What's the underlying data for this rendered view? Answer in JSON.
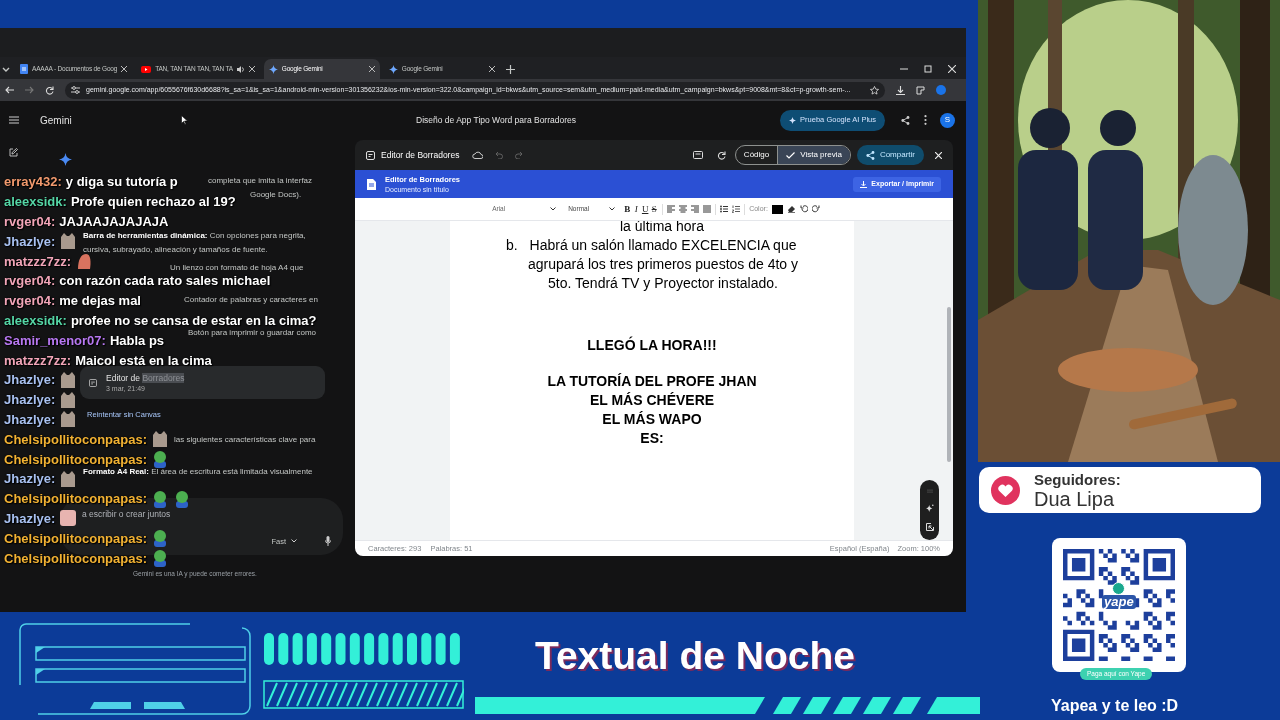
{
  "browser": {
    "tabs": [
      {
        "title": "AAAAA - Documentos de Goog",
        "kind": "docs",
        "audio": false,
        "selected": false
      },
      {
        "title": "TAN, TAN TAN TAN, TAN TA",
        "kind": "video",
        "audio": true,
        "selected": false
      },
      {
        "title": "Google Gemini",
        "kind": "gemini",
        "audio": false,
        "selected": true
      },
      {
        "title": "Google Gemini",
        "kind": "gemini",
        "audio": false,
        "selected": false
      }
    ],
    "url": "gemini.google.com/app/6055676f630d6688?is_sa=1&is_sa=1&android-min-version=301356232&ios-min-version=322.0&campaign_id=bkws&utm_source=sem&utm_medium=paid-media&utm_campaign=bkws&pt=9008&mt=8&ct=p-growth-sem-..."
  },
  "gemini": {
    "app_name": "Gemini",
    "conversation_title": "Diseño de App Tipo Word para Borradores",
    "upgrade_button": "Prueba Google AI Plus",
    "avatar": "S",
    "response_fragments": [
      "completa que imita la interfaz",
      "Google Docs).",
      "**Barra de herramientas dinámica:** Con opciones para negrita,",
      "cursiva, subrayado, alineación y tamaños de fuente.",
      "Un lienzo con formato de hoja A4 que",
      "Contador de palabras y caracteres en",
      "Botón para imprimir o guardar como",
      "las siguientes características clave para",
      "**Formato A4 Real:** El área de escritura está limitada visualmente"
    ],
    "canvas_card": {
      "title_prefix": "Editor de",
      "title_selected": "Borradores",
      "date": "3 mar, 21:49"
    },
    "retry_link": "Reintentar sin Canvas",
    "prompt_placeholder": "a escribir o crear juntos",
    "mode": "Fast",
    "disclaimer": "Gemini es una IA y puede cometer errores."
  },
  "canvas": {
    "title": "Editor de Borradores",
    "view_toggle": [
      {
        "label": "Código",
        "selected": false
      },
      {
        "label": "Vista previa",
        "selected": true
      }
    ],
    "share_button": "Compartir",
    "app": {
      "title": "Editor de Borradores",
      "subtitle": "Documento sin título",
      "export_button": "Exportar / Imprimir",
      "font": "Arial",
      "style": "Normal",
      "format_buttons": [
        "B",
        "I",
        "U",
        "S"
      ],
      "color_label": "Color:",
      "document": [
        {
          "kind": "continuation",
          "text": "la última hora"
        },
        {
          "kind": "list_item",
          "marker": "b.",
          "text": "Habrá un salón llamado EXCELENCIA que agrupará los tres primeros puestos de 4to y 5to. Tendrá TV y Proyector instalado."
        },
        {
          "kind": "heading",
          "text": "LLEGÓ LA HORA!!!"
        },
        {
          "kind": "heading_group",
          "lines": [
            "LA TUTORÍA DEL PROFE JHAN",
            "EL MÁS CHÉVERE",
            "EL MÁS WAPO",
            "ES:"
          ]
        }
      ],
      "status": {
        "characters": "Caracteres: 293",
        "words": "Palabras: 51",
        "language": "Español (España)",
        "zoom": "Zoom: 100%"
      }
    }
  },
  "chat": [
    {
      "user": "erray432:",
      "color": "#f29a6e",
      "text": "y diga su tutoría p"
    },
    {
      "user": "aleexsidk:",
      "color": "#55d6a6",
      "text": "Profe quien rechazo al 19?"
    },
    {
      "user": "rvger04:",
      "color": "#f2a5b8",
      "text": "JAJAAJAJAJAJA"
    },
    {
      "user": "Jhazlye:",
      "color": "#a9c2f2",
      "emotes": [
        {
          "kind": "cat"
        }
      ]
    },
    {
      "user": "matzzz7zz:",
      "color": "#f2a5b8",
      "emotes": [
        {
          "kind": "blob"
        }
      ]
    },
    {
      "user": "rvger04:",
      "color": "#f2a5b8",
      "text": "con razón cada rato sales michael"
    },
    {
      "user": "rvger04:",
      "color": "#f2a5b8",
      "text": "me dejas mal"
    },
    {
      "user": "aleexsidk:",
      "color": "#55d6a6",
      "text": "profee no se cansa de estar en la cima?"
    },
    {
      "user": "Samir_menor07:",
      "color": "#b878f2",
      "text": "Habla ps"
    },
    {
      "user": "matzzz7zz:",
      "color": "#f2a5b8",
      "text": "Maicol está en la cima"
    },
    {
      "user": "Jhazlye:",
      "color": "#a9c2f2",
      "emotes": [
        {
          "kind": "cat"
        }
      ]
    },
    {
      "user": "Jhazlye:",
      "color": "#a9c2f2",
      "emotes": [
        {
          "kind": "cat"
        }
      ]
    },
    {
      "user": "Jhazlye:",
      "color": "#a9c2f2",
      "emotes": [
        {
          "kind": "cat"
        }
      ]
    },
    {
      "user": "Chelsipollitoconpapas:",
      "color": "#f2b233",
      "emotes": [
        {
          "kind": "cat"
        }
      ]
    },
    {
      "user": "Chelsipollitoconpapas:",
      "color": "#f2b233",
      "emotes": [
        {
          "kind": "frog"
        }
      ]
    },
    {
      "user": "Jhazlye:",
      "color": "#a9c2f2",
      "emotes": [
        {
          "kind": "cat"
        }
      ]
    },
    {
      "user": "Chelsipollitoconpapas:",
      "color": "#f2b233",
      "emotes": [
        {
          "kind": "frog"
        },
        {
          "kind": "frog"
        }
      ]
    },
    {
      "user": "Jhazlye:",
      "color": "#a9c2f2",
      "emotes": [
        {
          "kind": "face"
        }
      ]
    },
    {
      "user": "Chelsipollitoconpapas:",
      "color": "#f2b233",
      "emotes": [
        {
          "kind": "frog"
        }
      ]
    },
    {
      "user": "Chelsipollitoconpapas:",
      "color": "#f2b233",
      "emotes": [
        {
          "kind": "frog"
        }
      ]
    }
  ],
  "followers": {
    "label": "Seguidores:",
    "name": "Dua Lipa"
  },
  "yape": {
    "logo_text": "yape",
    "badge": "Paga aquí con Yape",
    "caption": "Yapea y te leo :D"
  },
  "banner": {
    "title": "Textual de Noche"
  }
}
